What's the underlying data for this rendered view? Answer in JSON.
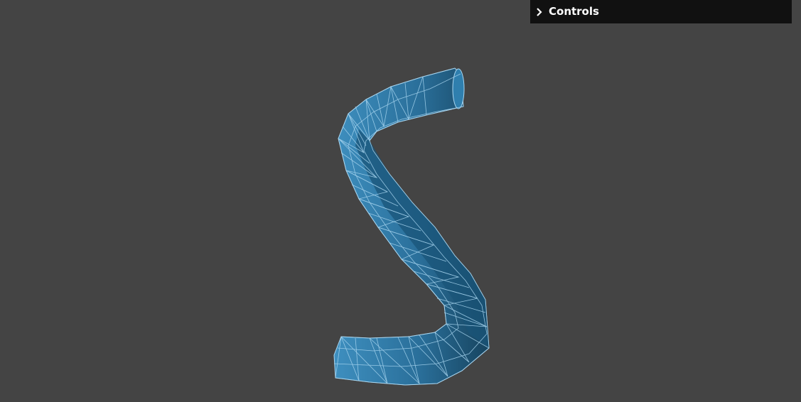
{
  "app": {
    "background_color": "#444444",
    "panel_color": "#111111"
  },
  "controls": {
    "label": "Controls",
    "icon": "chevron-right-icon",
    "state": "collapsed"
  },
  "mesh": {
    "description_icon": "tube-mesh-icon",
    "fill_color": "#2a6f9a",
    "edge_color": "#a9d6f0"
  }
}
